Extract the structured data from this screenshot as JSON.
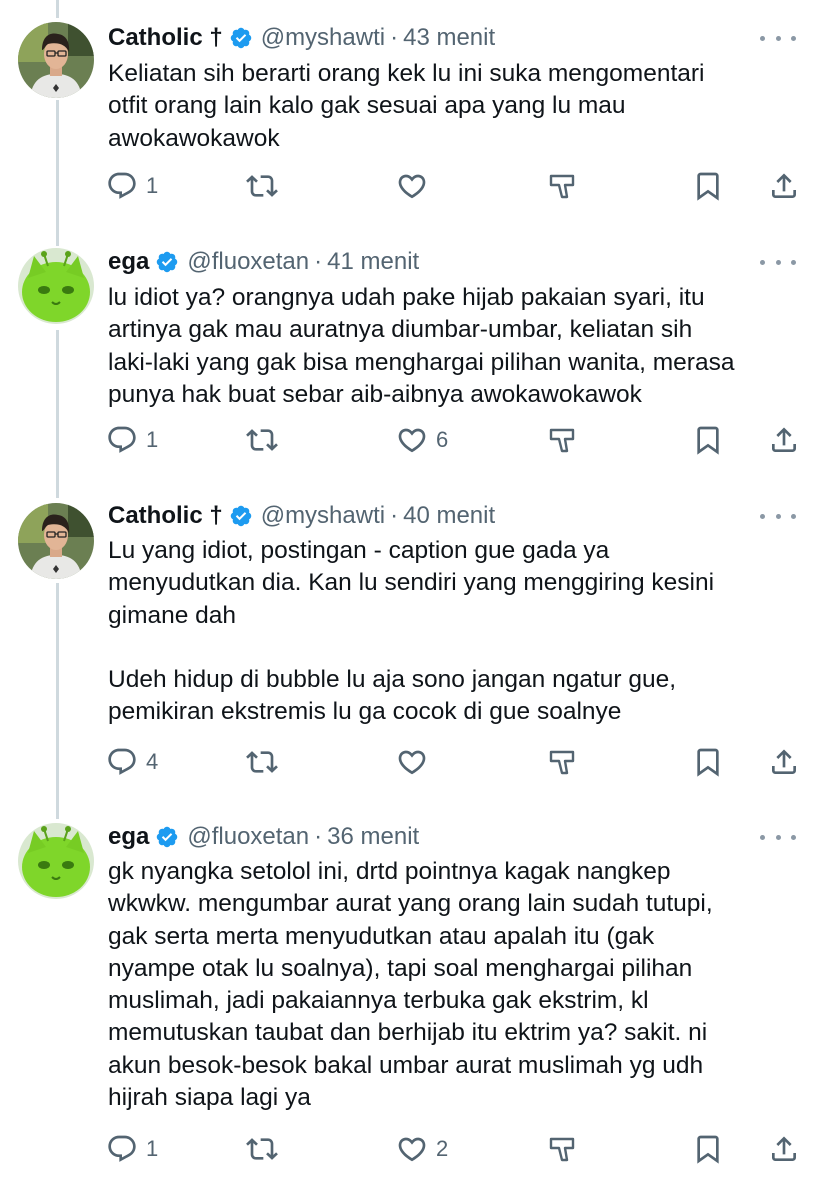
{
  "tweets": [
    {
      "name": "Catholic †",
      "handle": "@myshawti",
      "separator": "·",
      "time": "43 menit",
      "text": "Keliatan sih berarti orang kek lu ini suka mengomentari\notfit orang lain kalo gak sesuai apa yang lu mau\nawokawokawok",
      "replies": "1",
      "reposts": "",
      "likes": "",
      "avatar": "man-with-glasses-avatar"
    },
    {
      "name": "ega",
      "handle": "@fluoxetan",
      "separator": "·",
      "time": "41 menit",
      "text": "lu idiot ya? orangnya udah pake hijab pakaian syari, itu\nartinya gak mau auratnya diumbar-umbar, keliatan sih\nlaki-laki yang gak bisa menghargai pilihan wanita, merasa\npunya hak buat sebar aib-aibnya awokawokawok",
      "replies": "1",
      "reposts": "",
      "likes": "6",
      "avatar": "green-alien-cat-avatar"
    },
    {
      "name": "Catholic †",
      "handle": "@myshawti",
      "separator": "·",
      "time": "40 menit",
      "text": "Lu yang idiot, postingan - caption gue gada ya\nmenyudutkan dia. Kan lu sendiri yang menggiring kesini\ngimane dah\n\nUdeh hidup di bubble lu aja sono jangan ngatur gue,\npemikiran ekstremis lu ga cocok di gue soalnye",
      "replies": "4",
      "reposts": "",
      "likes": "",
      "avatar": "man-with-glasses-avatar"
    },
    {
      "name": "ega",
      "handle": "@fluoxetan",
      "separator": "·",
      "time": "36 menit",
      "text": "gk nyangka setolol ini, drtd pointnya kagak nangkep\nwkwkw. mengumbar aurat yang orang lain sudah tutupi,\ngak serta merta menyudutkan atau apalah itu (gak\nnyampe otak lu soalnya), tapi soal menghargai pilihan\nmuslimah, jadi pakaiannya terbuka gak ekstrim, kl\nmemutuskan taubat dan berhijab itu ektrim ya? sakit. ni\nakun besok-besok bakal umbar aurat muslimah yg udh\nhijrah siapa lagi ya",
      "replies": "1",
      "reposts": "",
      "likes": "2",
      "avatar": "green-alien-cat-avatar"
    }
  ],
  "icons": {
    "reply": "reply-icon",
    "repost": "repost-icon",
    "like": "heart-icon",
    "views": "views-icon",
    "bookmark": "bookmark-icon",
    "share": "share-icon",
    "verified": "verified-badge-icon",
    "more": "more-options-icon"
  },
  "colors": {
    "text": "#0f1419",
    "secondary": "#536471",
    "verified": "#1d9bf0",
    "thread_line": "#cfd9de"
  }
}
